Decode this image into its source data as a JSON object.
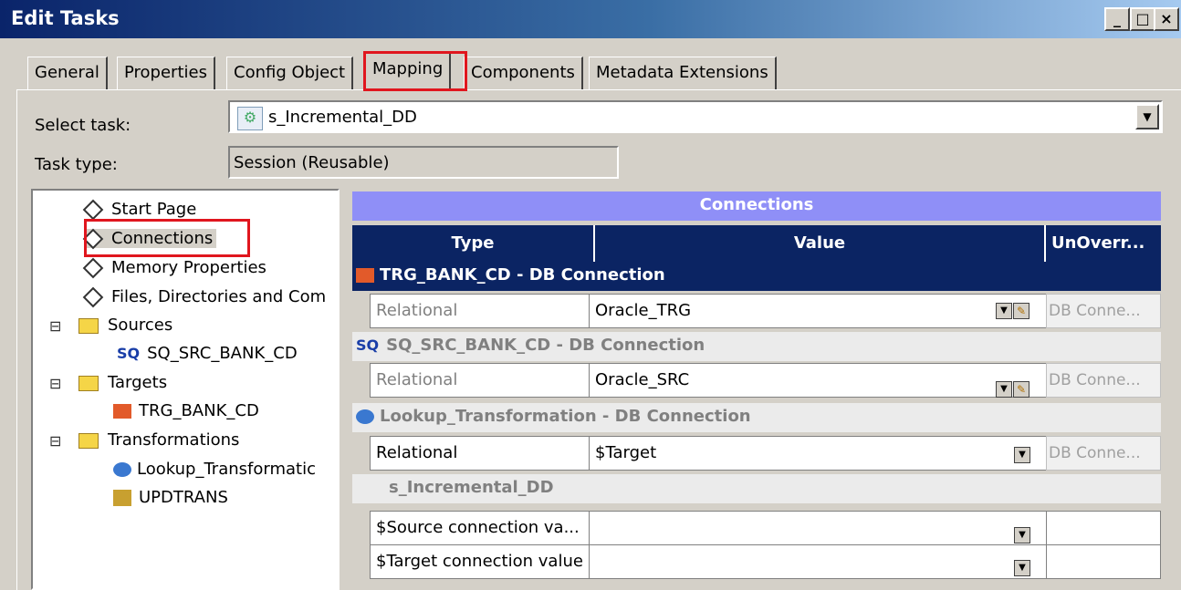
{
  "window": {
    "title": "Edit Tasks",
    "controls": [
      "_",
      "□",
      "×"
    ]
  },
  "tabs": [
    {
      "label": "General"
    },
    {
      "label": "Properties"
    },
    {
      "label": "Config Object"
    },
    {
      "label": "Mapping",
      "active": true
    },
    {
      "label": "Components"
    },
    {
      "label": "Metadata Extensions"
    }
  ],
  "form": {
    "select_task_label": "Select task:",
    "select_task_value": "s_Incremental_DD",
    "task_type_label": "Task type:",
    "task_type_value": "Session (Reusable)"
  },
  "tree": {
    "items": [
      {
        "label": "Start Page"
      },
      {
        "label": "Connections",
        "selected": true
      },
      {
        "label": "Memory Properties"
      },
      {
        "label": "Files, Directories and Com"
      },
      {
        "label": "Sources"
      },
      {
        "label": "SQ_SRC_BANK_CD",
        "icon_text": "SQ"
      },
      {
        "label": "Targets"
      },
      {
        "label": "TRG_BANK_CD"
      },
      {
        "label": "Transformations"
      },
      {
        "label": "Lookup_Transformatic"
      },
      {
        "label": "UPDTRANS"
      }
    ],
    "expand_symbol": "⊟"
  },
  "grid": {
    "title": "Connections",
    "columns": [
      "Type",
      "Value",
      "UnOverr..."
    ],
    "groups": [
      {
        "title": "TRG_BANK_CD - DB Connection",
        "icon_name": "target-icon",
        "rows": [
          {
            "type": "Relational",
            "value": "Oracle_TRG",
            "unoverride": "DB Conne..."
          }
        ]
      },
      {
        "title": "SQ_SRC_BANK_CD - DB Connection",
        "icon_text": "SQ",
        "rows": [
          {
            "type": "Relational",
            "value": "Oracle_SRC",
            "unoverride": "DB Conne..."
          }
        ]
      },
      {
        "title": "Lookup_Transformation - DB Connection",
        "icon_name": "lookup-icon",
        "rows": [
          {
            "type": "Relational",
            "value": "$Target",
            "unoverride": "DB Conne..."
          }
        ]
      },
      {
        "title": "s_Incremental_DD",
        "rows": [
          {
            "type": "$Source connection va...",
            "value": "",
            "unoverride": ""
          },
          {
            "type": "$Target connection value",
            "value": "",
            "unoverride": ""
          }
        ]
      }
    ]
  },
  "colors": {
    "highlight_red": "#e0161e",
    "header_navy": "#0b2463",
    "connections_bar": "#8f8ff7"
  }
}
